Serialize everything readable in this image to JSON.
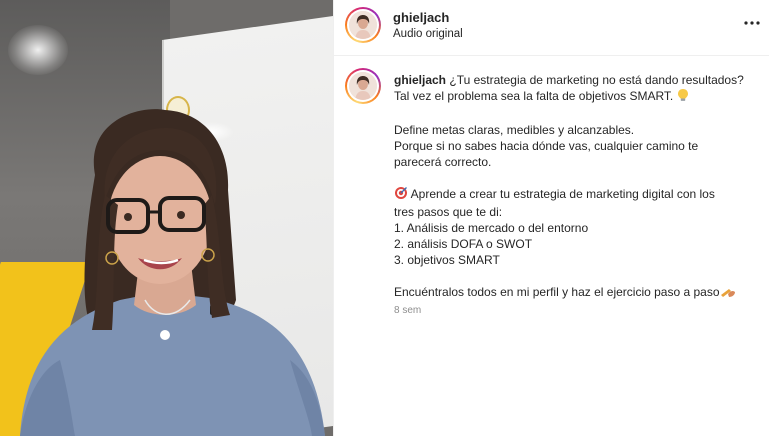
{
  "post": {
    "username": "ghieljach",
    "audio": "Audio original",
    "caption": {
      "line1": "¿Tu estrategia de marketing no está dando resultados?",
      "line2": "Tal vez el problema sea la falta de objetivos SMART.",
      "para2_line1": "Define metas claras, medibles y alcanzables.",
      "para2_line2": "Porque si no sabes hacia dónde vas, cualquier camino te",
      "para2_line3": "parecerá correcto.",
      "para3_line1": "Aprende a crear tu estrategia de marketing digital con los",
      "para3_line2": "tres pasos que te di:",
      "list": [
        "1. Análisis de mercado o del entorno",
        "2. análisis DOFA o SWOT",
        "3. objetivos SMART"
      ],
      "closing": "Encuéntralos todos en mi perfil y haz el ejercicio paso a paso"
    },
    "timestamp": "8 sem"
  },
  "icons": {
    "more": "more-options-icon",
    "bulb": "lightbulb-icon",
    "target": "target-icon",
    "writing": "writing-hand-icon"
  },
  "colors": {
    "text": "#262626",
    "muted": "#8e8e8e",
    "sweater": "#7e93b4",
    "accent_yellow": "#f2c21b"
  }
}
